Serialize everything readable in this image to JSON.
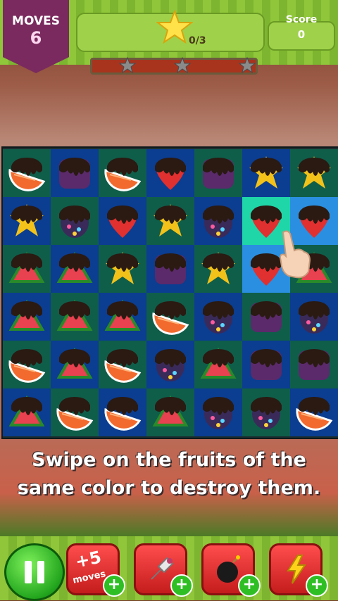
{
  "hud": {
    "moves_label": "MOVES",
    "moves_value": "6",
    "goal_text": "0/3",
    "score_label": "Score",
    "score_value": "0",
    "progress_fraction": 0.0
  },
  "board": {
    "rows": 6,
    "cols": 7,
    "pieces": [
      [
        "orange",
        "grape",
        "orange",
        "strawberry",
        "grape",
        "star",
        "star"
      ],
      [
        "star",
        "candy",
        "strawberry",
        "star",
        "candy",
        "strawberry",
        "strawberry"
      ],
      [
        "watermelon",
        "watermelon",
        "star",
        "grape",
        "star",
        "strawberry",
        "watermelon"
      ],
      [
        "watermelon",
        "watermelon",
        "watermelon",
        "orange",
        "candy",
        "grape",
        "candy"
      ],
      [
        "orange",
        "watermelon",
        "orange",
        "candy",
        "watermelon",
        "grape",
        "grape"
      ],
      [
        "watermelon",
        "orange",
        "orange",
        "watermelon",
        "candy",
        "candy",
        "orange"
      ]
    ],
    "highlighted_cells": [
      [
        1,
        5
      ],
      [
        1,
        6
      ],
      [
        2,
        5
      ]
    ]
  },
  "tutorial": {
    "line1": "Swipe on the fruits of the",
    "line2": "same color to destroy them."
  },
  "boosters": {
    "moves_booster_label": "+5",
    "moves_booster_sub": "moves"
  },
  "colors": {
    "tile_blue": "#0b3d91",
    "tile_green": "#0f5e4a",
    "highlight_green": "#1fd6a8",
    "highlight_blue": "#2a8fe0",
    "orange": "#f26a2e",
    "grape": "#5a2a6b",
    "strawberry": "#e0302f",
    "star": "#f2c21a",
    "candy": "#3a2a5a",
    "watermelon": "#e8414f",
    "chocolate": "#2a1a12"
  }
}
